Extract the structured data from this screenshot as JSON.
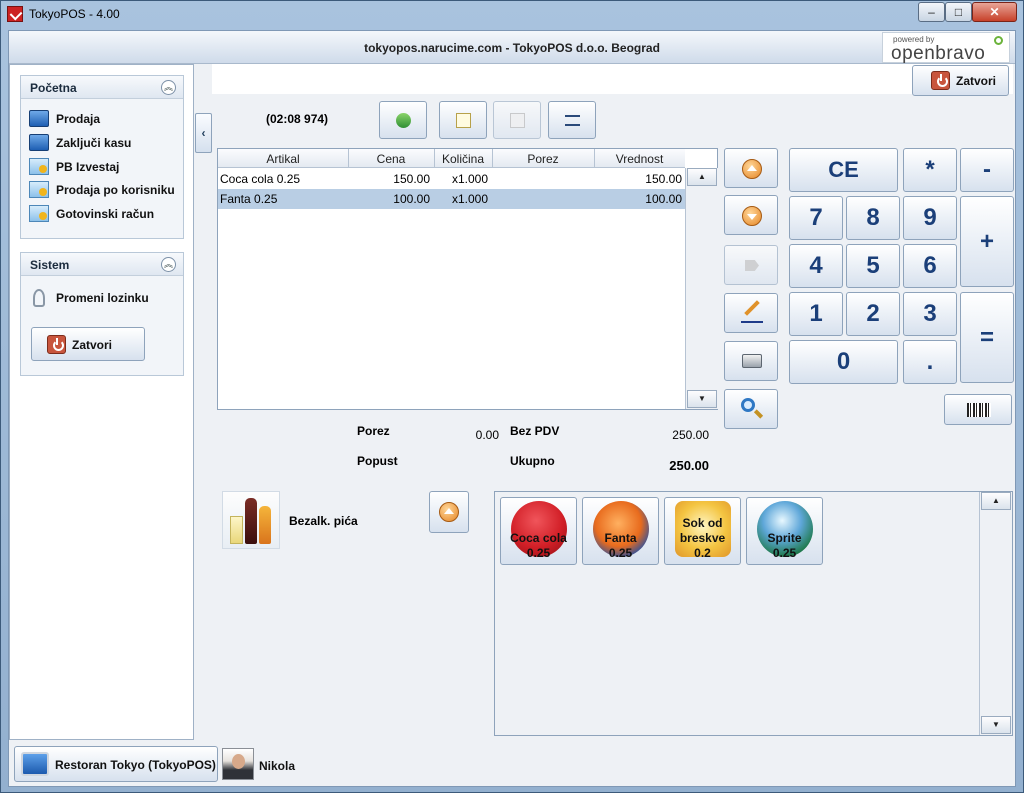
{
  "window": {
    "title": "TokyoPOS - 4.00",
    "min": "–",
    "max": "□",
    "close": "✕"
  },
  "header": {
    "title": "tokyopos.narucime.com - TokyoPOS d.o.o. Beograd",
    "logo_small": "powered by",
    "logo_big": "openbravo"
  },
  "sidebar": {
    "pocetna": {
      "title": "Početna",
      "items": [
        {
          "label": "Prodaja",
          "icon": "monitor-icon"
        },
        {
          "label": "Zaključi kasu",
          "icon": "monitor-icon"
        },
        {
          "label": "PB Izvestaj",
          "icon": "report-icon"
        },
        {
          "label": "Prodaja po korisniku",
          "icon": "report-icon"
        },
        {
          "label": "Gotovinski račun",
          "icon": "report-icon"
        }
      ]
    },
    "sistem": {
      "title": "Sistem",
      "items": [
        {
          "label": "Promeni lozinku",
          "icon": "key-icon"
        }
      ],
      "close_label": "Zatvori"
    },
    "collapse": "‹"
  },
  "main": {
    "close_label": "Zatvori",
    "order_id": "(02:08 974)",
    "ticket": {
      "columns": [
        "Artikal",
        "Cena",
        "Količina",
        "Porez",
        "Vrednost"
      ],
      "rows": [
        {
          "item": "Coca cola 0.25",
          "price": "150.00",
          "qty": "x1.000",
          "tax": "",
          "value": "150.00"
        },
        {
          "item": "Fanta 0.25",
          "price": "100.00",
          "qty": "x1.000",
          "tax": "",
          "value": "100.00"
        }
      ],
      "selected_row": 1
    },
    "totals": {
      "porez_label": "Porez",
      "porez_value": "0.00",
      "bezpdv_label": "Bez PDV",
      "bezpdv_value": "250.00",
      "popust_label": "Popust",
      "ukupno_label": "Ukupno",
      "ukupno_value": "250.00"
    },
    "keypad": {
      "ce": "CE",
      "mul": "*",
      "minus": "-",
      "plus": "+",
      "eq": "=",
      "dot": ".",
      "k0": "0",
      "k1": "1",
      "k2": "2",
      "k3": "3",
      "k4": "4",
      "k5": "5",
      "k6": "6",
      "k7": "7",
      "k8": "8",
      "k9": "9"
    },
    "category": {
      "label": "Bezalk. pića"
    },
    "products": [
      {
        "line1": "Coca cola",
        "line2": "0.25",
        "color": "#d21f27"
      },
      {
        "line1": "Fanta",
        "line2": "0.25",
        "color": "#e86b1d"
      },
      {
        "line1": "Sok od breskve",
        "line2": "0.2",
        "color": "#f4c542"
      },
      {
        "line1": "Sprite",
        "line2": "0.25",
        "color": "#1f7a4d"
      }
    ],
    "product_lines_peach": [
      "Sok od",
      "breskve"
    ]
  },
  "status": {
    "location": "Restoran Tokyo (TokyoPOS)",
    "user": "Nikola"
  }
}
